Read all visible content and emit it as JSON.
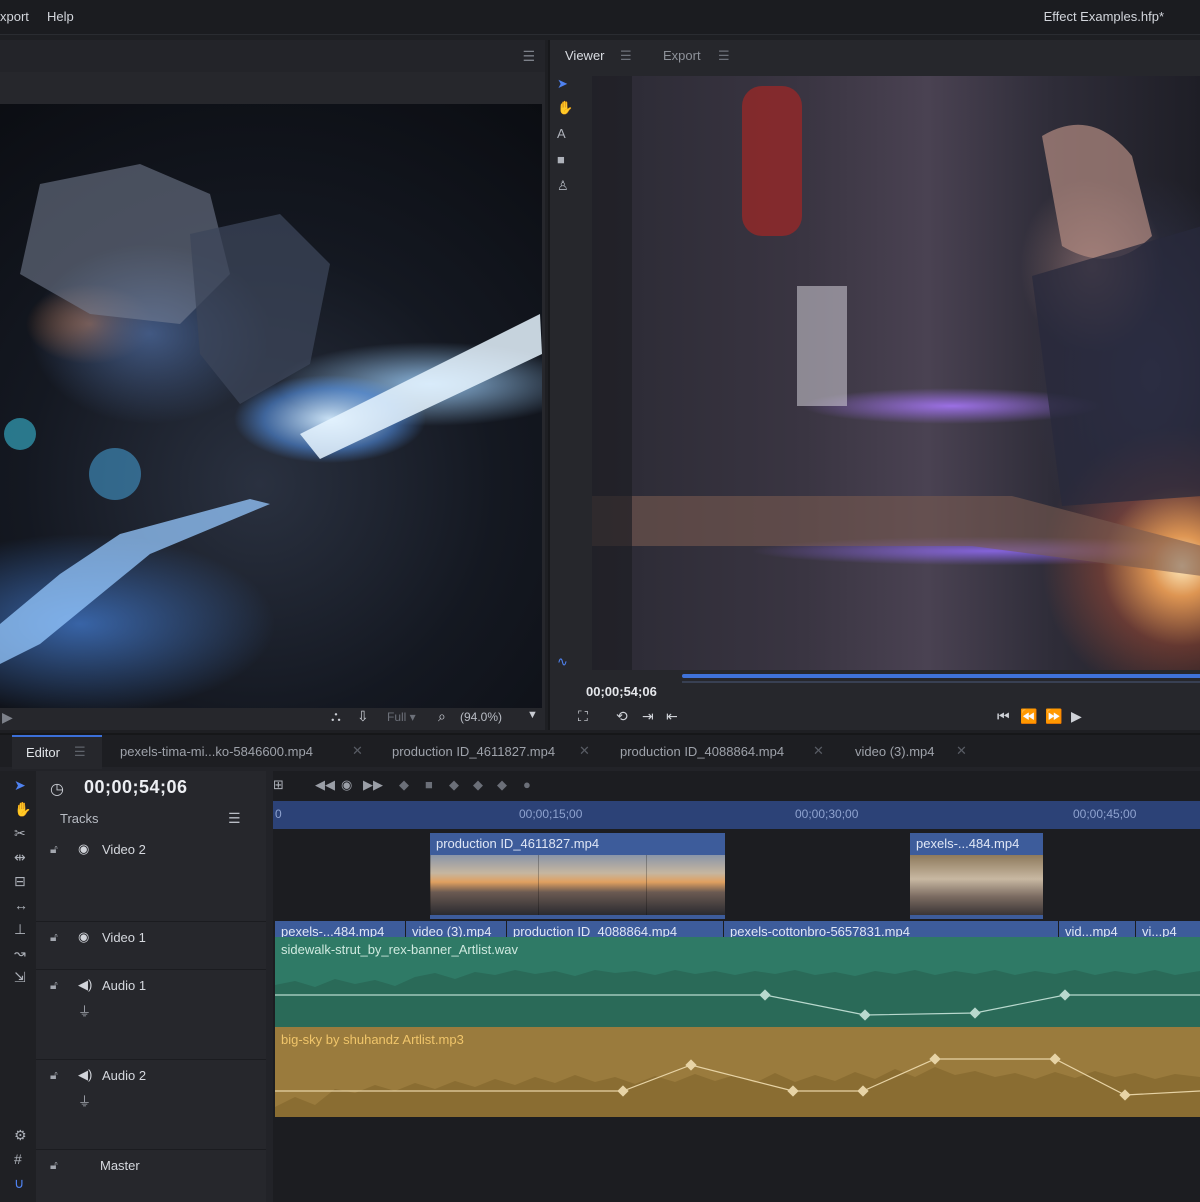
{
  "menubar": {
    "items": [
      "xport",
      "Help"
    ],
    "project_title": "Effect Examples.hfp*"
  },
  "left_panel": {
    "menu_icon": "menu-icon",
    "quality": "Full",
    "zoom": "(94.0%)"
  },
  "viewer": {
    "tabs": [
      {
        "label": "Viewer",
        "active": true
      },
      {
        "label": "Export",
        "active": false
      }
    ],
    "tools": [
      "select-arrow-icon",
      "hand-icon",
      "text-icon",
      "mask-rectangle-icon",
      "pen-icon"
    ],
    "timecode": "00;00;54;06",
    "scrub_progress": 1.0
  },
  "editor": {
    "tabs": [
      {
        "label": "Editor",
        "active": true
      },
      {
        "label": "pexels-tima-mi...ko-5846600.mp4"
      },
      {
        "label": "production ID_4611827.mp4"
      },
      {
        "label": "production ID_4088864.mp4"
      },
      {
        "label": "video (3).mp4"
      }
    ],
    "timecode": "00;00;54;06",
    "tracks_label": "Tracks",
    "tracks": [
      {
        "name": "Video 2",
        "type": "video"
      },
      {
        "name": "Video 1",
        "type": "video"
      },
      {
        "name": "Audio 1",
        "type": "audio"
      },
      {
        "name": "Audio 2",
        "type": "audio"
      },
      {
        "name": "Master",
        "type": "master"
      }
    ],
    "ruler_labels": [
      "0",
      "00;00;15;00",
      "00;00;30;00",
      "00;00;45;00"
    ],
    "video2_clips": [
      {
        "label": "production ID_4611827.mp4"
      },
      {
        "label": "pexels-...484.mp4"
      }
    ],
    "video1_clips": [
      {
        "label": "pexels-...484.mp4"
      },
      {
        "label": "video (3).mp4"
      },
      {
        "label": "production ID_4088864.mp4"
      },
      {
        "label": "pexels-cottonbro-5657831.mp4"
      },
      {
        "label": "vid...mp4"
      },
      {
        "label": "vi...p4"
      }
    ],
    "audio_clips": [
      {
        "label": "sidewalk-strut_by_rex-banner_Artlist.wav",
        "color": "#2f7a66"
      },
      {
        "label": "big-sky by shuhandz Artlist.mp3",
        "color": "#9a7b3d"
      }
    ]
  },
  "colors": {
    "accent": "#3f72d8",
    "video_clip": "#3d5c9b",
    "audio1": "#2f7a66",
    "audio2": "#9a7b3d"
  }
}
